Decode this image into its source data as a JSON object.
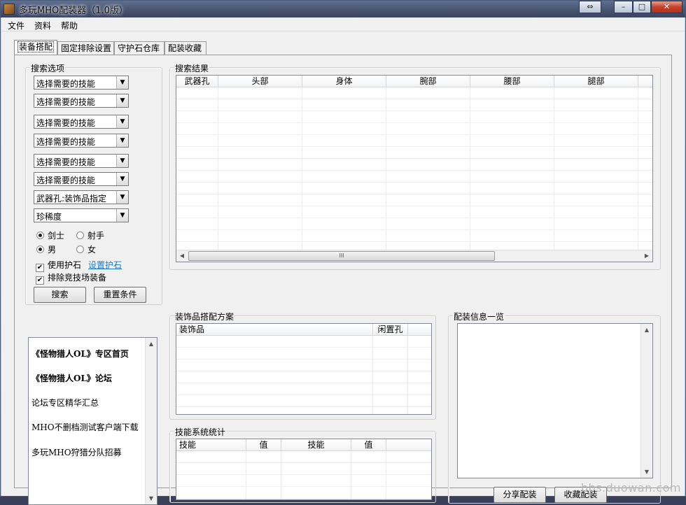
{
  "window": {
    "title": "多玩MHO配装器（1.0版）"
  },
  "title_buttons": {
    "restore": "⇔",
    "minimize": "–",
    "maximize": "□",
    "close": "✕"
  },
  "menu": [
    "文件",
    "资料",
    "帮助"
  ],
  "tabs": [
    "装备搭配",
    "固定排除设置",
    "守护石仓库",
    "配装收藏"
  ],
  "search_options": {
    "label": "搜索选项",
    "combos": [
      "选择需要的技能",
      "选择需要的技能",
      "选择需要的技能",
      "选择需要的技能",
      "选择需要的技能",
      "选择需要的技能",
      "武器孔:装饰品指定",
      "珍稀度"
    ],
    "weapon_type": {
      "swordsman": "剑士",
      "gunner": "射手",
      "selected": "剑士"
    },
    "gender": {
      "male": "男",
      "female": "女",
      "selected": "男"
    },
    "use_guard_stone": {
      "label": "使用护石",
      "checked": true,
      "link": "设置护石"
    },
    "exclude_arena": {
      "label": "排除竞技场装备",
      "checked": true
    },
    "search_button": "搜索",
    "reset_button": "重置条件"
  },
  "links_panel": {
    "items": [
      {
        "text": "《怪物猎人OL》专区首页",
        "bold": true
      },
      {
        "text": "《怪物猎人OL》论坛",
        "bold": true
      },
      {
        "text": "论坛专区精华汇总",
        "bold": false
      },
      {
        "text": "MHO不删档测试客户端下载",
        "bold": false
      },
      {
        "text": "多玩MHO狩猎分队招募",
        "bold": false
      }
    ]
  },
  "search_results": {
    "label": "搜索结果",
    "columns": [
      "武器孔",
      "头部",
      "身体",
      "腕部",
      "腰部",
      "腿部"
    ],
    "scroll_thumb": "III"
  },
  "decoration_plan": {
    "label": "装饰品搭配方案",
    "columns": [
      "装饰品",
      "闲置孔"
    ]
  },
  "skill_stats": {
    "label": "技能系统统计",
    "columns": [
      "技能",
      "值",
      "技能",
      "值"
    ]
  },
  "loadout_info": {
    "label": "配装信息一览",
    "share_button": "分享配装",
    "favorite_button": "收藏配装"
  },
  "watermark": "bbs.duowan.com",
  "icons": {
    "scroll_up": "▲",
    "scroll_down": "▼",
    "scroll_left": "◀",
    "scroll_right": "▶",
    "combo_arrow": "▼",
    "check_mark": "✔"
  }
}
